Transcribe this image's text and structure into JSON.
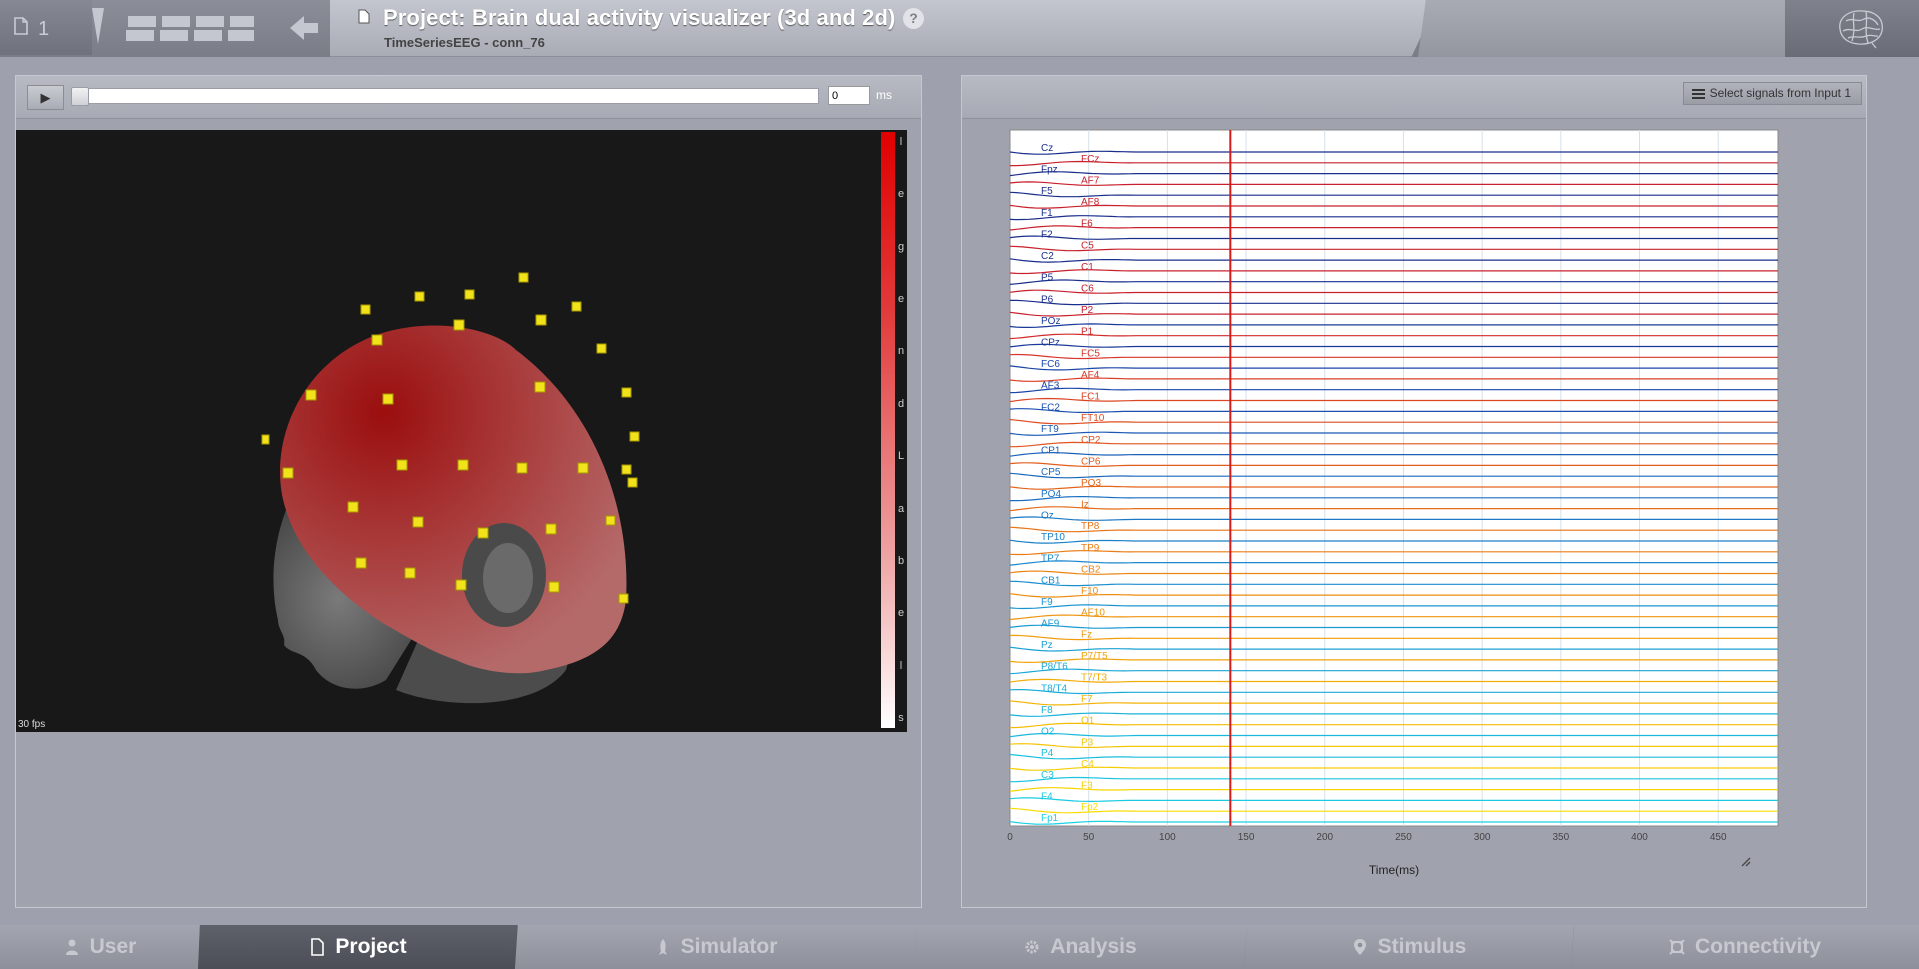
{
  "header": {
    "project_count": "1",
    "title": "Project: Brain dual activity visualizer (3d and 2d)",
    "subtitle": "TimeSeriesEEG - conn_76",
    "help_label": "?"
  },
  "player": {
    "play_label": "▶",
    "time_value": "0",
    "time_unit": "ms",
    "fps": "30 fps",
    "legend_letters": [
      "l",
      "e",
      "g",
      "e",
      "n",
      "d",
      "L",
      "a",
      "b",
      "e",
      "l",
      "s"
    ]
  },
  "signals_button": "Select signals from Input 1",
  "chart_data": {
    "type": "line",
    "xlabel": "Time(ms)",
    "xlim": [
      0,
      488
    ],
    "x_ticks": [
      0,
      50,
      100,
      150,
      200,
      250,
      300,
      350,
      400,
      450
    ],
    "cursor_time": 140,
    "channels": [
      {
        "name": "Cz",
        "color": "#1a2e8c"
      },
      {
        "name": "FCz",
        "color": "#c8202c"
      },
      {
        "name": "Fpz",
        "color": "#1a2e8c"
      },
      {
        "name": "AF7",
        "color": "#c8202c"
      },
      {
        "name": "F5",
        "color": "#1a2e8c"
      },
      {
        "name": "AF8",
        "color": "#c8202c"
      },
      {
        "name": "F1",
        "color": "#1a2e8c"
      },
      {
        "name": "F6",
        "color": "#c8202c"
      },
      {
        "name": "F2",
        "color": "#1a2e8c"
      },
      {
        "name": "C5",
        "color": "#c8202c"
      },
      {
        "name": "C2",
        "color": "#1a2e8c"
      },
      {
        "name": "C1",
        "color": "#c8202c"
      },
      {
        "name": "P5",
        "color": "#1a2e8c"
      },
      {
        "name": "C6",
        "color": "#c8202c"
      },
      {
        "name": "P6",
        "color": "#1a2e8c"
      },
      {
        "name": "P2",
        "color": "#c8202c"
      },
      {
        "name": "POz",
        "color": "#1a3a9a"
      },
      {
        "name": "P1",
        "color": "#d02a2a"
      },
      {
        "name": "CPz",
        "color": "#1a3a9a"
      },
      {
        "name": "FC5",
        "color": "#d8362a"
      },
      {
        "name": "FC6",
        "color": "#1a45a6"
      },
      {
        "name": "AF4",
        "color": "#da3c26"
      },
      {
        "name": "AF3",
        "color": "#1a45a6"
      },
      {
        "name": "FC1",
        "color": "#dc4422"
      },
      {
        "name": "FC2",
        "color": "#1a4fae"
      },
      {
        "name": "FT10",
        "color": "#de4c20"
      },
      {
        "name": "FT9",
        "color": "#1a58b4"
      },
      {
        "name": "CP2",
        "color": "#e0541e"
      },
      {
        "name": "CP1",
        "color": "#1a60b8"
      },
      {
        "name": "CP6",
        "color": "#e25c1c"
      },
      {
        "name": "CP5",
        "color": "#1a68bc"
      },
      {
        "name": "PO3",
        "color": "#e4641a"
      },
      {
        "name": "PO4",
        "color": "#1a70c0"
      },
      {
        "name": "Iz",
        "color": "#e66c18"
      },
      {
        "name": "Oz",
        "color": "#1a78c4"
      },
      {
        "name": "TP8",
        "color": "#e87416"
      },
      {
        "name": "TP10",
        "color": "#1a80c8"
      },
      {
        "name": "TP9",
        "color": "#ea7c14"
      },
      {
        "name": "TP7",
        "color": "#1a88cc"
      },
      {
        "name": "CB2",
        "color": "#ec8412"
      },
      {
        "name": "CB1",
        "color": "#1a8ece"
      },
      {
        "name": "F10",
        "color": "#ee8c10"
      },
      {
        "name": "F9",
        "color": "#1a94d0"
      },
      {
        "name": "AF10",
        "color": "#ef940e"
      },
      {
        "name": "AF9",
        "color": "#1a9ad2"
      },
      {
        "name": "Fz",
        "color": "#f09c0c"
      },
      {
        "name": "Pz",
        "color": "#1aa0d4"
      },
      {
        "name": "P7/T5",
        "color": "#f1a40a"
      },
      {
        "name": "P8/T6",
        "color": "#1aa6d6"
      },
      {
        "name": "T7/T3",
        "color": "#f2ac08"
      },
      {
        "name": "T8/T4",
        "color": "#1aacd8"
      },
      {
        "name": "F7",
        "color": "#f3b406"
      },
      {
        "name": "F8",
        "color": "#1ab2da"
      },
      {
        "name": "O1",
        "color": "#f4bc04"
      },
      {
        "name": "O2",
        "color": "#1ab8dc"
      },
      {
        "name": "P3",
        "color": "#f5c403"
      },
      {
        "name": "P4",
        "color": "#1abede"
      },
      {
        "name": "C4",
        "color": "#f6cc02"
      },
      {
        "name": "C3",
        "color": "#1ac4e0"
      },
      {
        "name": "F3",
        "color": "#f7d401"
      },
      {
        "name": "F4",
        "color": "#1acae2"
      },
      {
        "name": "Fp2",
        "color": "#f8dc00"
      },
      {
        "name": "Fp1",
        "color": "#1ad0e4"
      }
    ]
  },
  "footer": {
    "tabs": [
      {
        "label": "User",
        "icon": "user-icon",
        "active": false
      },
      {
        "label": "Project",
        "icon": "document-icon",
        "active": true
      },
      {
        "label": "Simulator",
        "icon": "rocket-icon",
        "active": false
      },
      {
        "label": "Analysis",
        "icon": "gear-icon",
        "active": false
      },
      {
        "label": "Stimulus",
        "icon": "pin-icon",
        "active": false
      },
      {
        "label": "Connectivity",
        "icon": "connectivity-icon",
        "active": false
      }
    ]
  }
}
